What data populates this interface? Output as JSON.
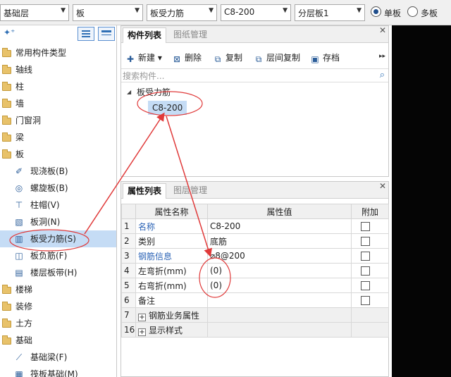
{
  "toolbar": {
    "floor": "基础层",
    "category": "板",
    "component_type": "板受力筋",
    "component": "C8-200",
    "layer": "分层板1",
    "single_slab": "单板",
    "multi_slab": "多板"
  },
  "sidebar": {
    "items": [
      {
        "label": "常用构件类型"
      },
      {
        "label": "轴线"
      },
      {
        "label": "柱"
      },
      {
        "label": "墙"
      },
      {
        "label": "门窗洞"
      },
      {
        "label": "梁"
      },
      {
        "label": "板"
      },
      {
        "label": "现浇板(B)"
      },
      {
        "label": "螺旋板(B)"
      },
      {
        "label": "柱帽(V)"
      },
      {
        "label": "板洞(N)"
      },
      {
        "label": "板受力筋(S)"
      },
      {
        "label": "板负筋(F)"
      },
      {
        "label": "楼层板带(H)"
      },
      {
        "label": "楼梯"
      },
      {
        "label": "装修"
      },
      {
        "label": "土方"
      },
      {
        "label": "基础"
      },
      {
        "label": "基础梁(F)"
      },
      {
        "label": "筏板基础(M)"
      }
    ]
  },
  "component_panel": {
    "tabs": [
      "构件列表",
      "图纸管理"
    ],
    "buttons": {
      "new": "新建",
      "delete": "删除",
      "copy": "复制",
      "floor_copy": "层间复制",
      "archive": "存档"
    },
    "search_placeholder": "搜索构件...",
    "tree": {
      "parent": "板受力筋",
      "child": "C8-200"
    }
  },
  "property_panel": {
    "tabs": [
      "属性列表",
      "图层管理"
    ],
    "headers": {
      "name": "属性名称",
      "value": "属性值",
      "extra": "附加"
    },
    "rows": [
      {
        "num": "1",
        "name": "名称",
        "value": "C8-200"
      },
      {
        "num": "2",
        "name": "类别",
        "value": "底筋"
      },
      {
        "num": "3",
        "name": "钢筋信息",
        "value": "⌀8@200"
      },
      {
        "num": "4",
        "name": "左弯折(mm)",
        "value": "(0)"
      },
      {
        "num": "5",
        "name": "右弯折(mm)",
        "value": "(0)"
      },
      {
        "num": "6",
        "name": "备注",
        "value": ""
      },
      {
        "num": "7",
        "name": "钢筋业务属性",
        "value": ""
      },
      {
        "num": "16",
        "name": "显示样式",
        "value": ""
      }
    ]
  },
  "colors": {
    "selection": "#c5dcf5",
    "link_blue": "#2a62b5",
    "annotation_red": "#e03a3a"
  }
}
